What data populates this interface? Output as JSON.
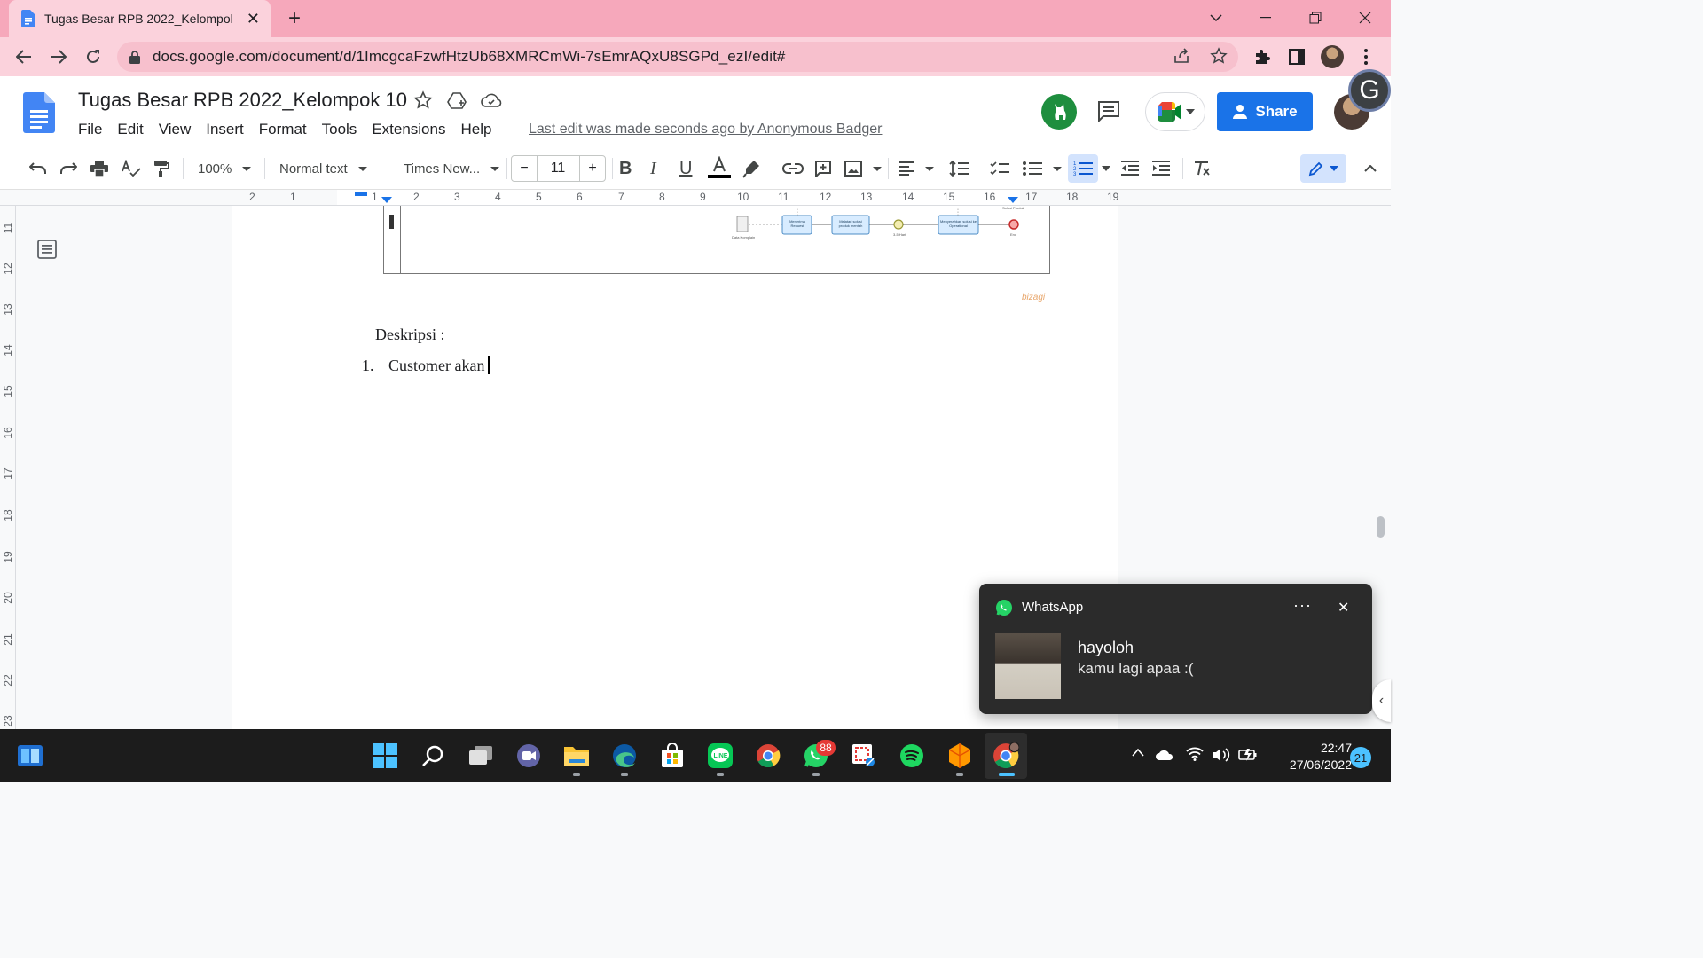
{
  "browser": {
    "tab_title": "Tugas Besar RPB 2022_Kelompok 10",
    "url": "docs.google.com/document/d/1ImcgcaFzwfHtzUb68XMRCmWi-7sEmrAQxU8SGPd_ezI/edit#"
  },
  "docs": {
    "title": "Tugas Besar RPB 2022_Kelompok 10",
    "menu": [
      "File",
      "Edit",
      "View",
      "Insert",
      "Format",
      "Tools",
      "Extensions",
      "Help"
    ],
    "last_edit": "Last edit was made seconds ago by Anonymous Badger",
    "share_label": "Share",
    "avatar_badge": "G"
  },
  "toolbar": {
    "zoom": "100%",
    "style": "Normal text",
    "font": "Times New...",
    "font_size": "11"
  },
  "ruler": {
    "h": [
      "2",
      "1",
      "1",
      "2",
      "3",
      "4",
      "5",
      "6",
      "7",
      "8",
      "9",
      "10",
      "11",
      "12",
      "13",
      "14",
      "15",
      "16",
      "17",
      "18",
      "19"
    ],
    "v": [
      "11",
      "12",
      "13",
      "14",
      "15",
      "16",
      "17",
      "18",
      "19",
      "20",
      "21",
      "22",
      "23"
    ]
  },
  "document": {
    "diagram": {
      "nodes": [
        "Menerima Request",
        "Melatari solusi produk mentah",
        "Menyerahkan solusi ke Operational"
      ],
      "labels": [
        "Data Komplain",
        "3-5 Hari",
        "Solusi Produk",
        "End"
      ],
      "watermark": "bizagi"
    },
    "heading": "Deskripsi :",
    "list_number": "1.",
    "list_item": "Customer akan"
  },
  "notification": {
    "app": "WhatsApp",
    "sender": "hayoloh",
    "message": "kamu lagi apaa :("
  },
  "taskbar": {
    "whatsapp_badge": "88",
    "time": "22:47",
    "date": "27/06/2022",
    "notification_count": "21"
  },
  "colors": {
    "chrome_frame": "#f6a8bb",
    "share_blue": "#1a73e8",
    "taskbar": "#1c1c1c"
  }
}
